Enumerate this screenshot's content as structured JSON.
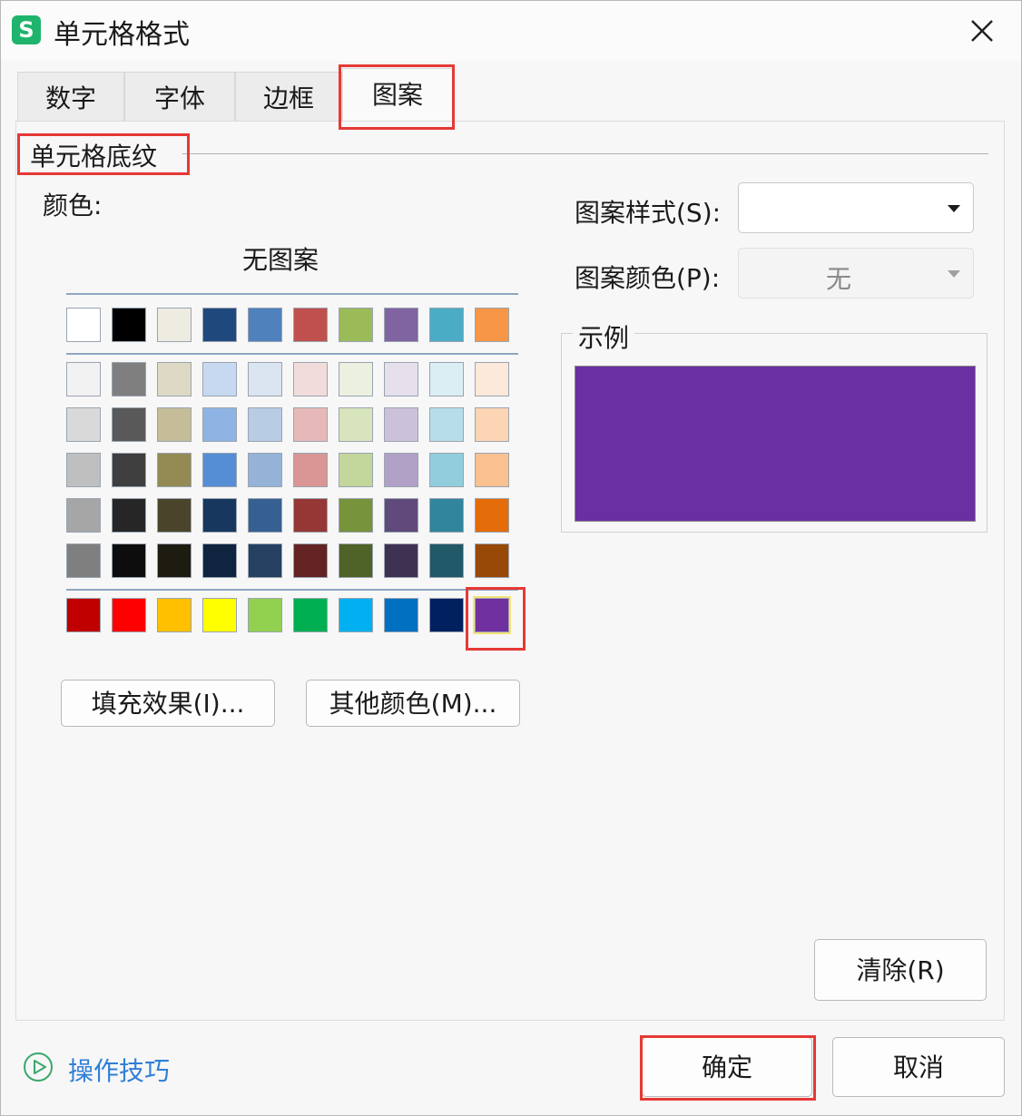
{
  "window": {
    "title": "单元格格式",
    "app_icon_letter": "S"
  },
  "tabs": [
    {
      "label": "数字",
      "active": false
    },
    {
      "label": "字体",
      "active": false
    },
    {
      "label": "边框",
      "active": false
    },
    {
      "label": "图案",
      "active": true
    }
  ],
  "shading": {
    "group_title": "单元格底纹",
    "color_label": "颜色:",
    "no_pattern_label": "无图案",
    "row1": [
      "#ffffff",
      "#000000",
      "#eeece1",
      "#1f497d",
      "#4f81bd",
      "#c0504d",
      "#9bbb59",
      "#8064a2",
      "#4bacc6",
      "#f79646"
    ],
    "tints": [
      [
        "#f2f2f2",
        "#7f7f7f",
        "#ddd9c4",
        "#c6d9f1",
        "#dbe5f1",
        "#f2dcdb",
        "#ebf1de",
        "#e5e0ec",
        "#dbeef3",
        "#fde9d9"
      ],
      [
        "#d9d9d9",
        "#595959",
        "#c4bd97",
        "#8eb4e3",
        "#b8cce4",
        "#e6b9b8",
        "#d7e4bc",
        "#ccc1da",
        "#b7dee8",
        "#fcd5b4"
      ],
      [
        "#bfbfbf",
        "#3f3f3f",
        "#948a54",
        "#558ed5",
        "#95b3d7",
        "#d99694",
        "#c3d69b",
        "#b2a1c7",
        "#92cddc",
        "#fac090"
      ],
      [
        "#a6a6a6",
        "#262626",
        "#4a452a",
        "#17375e",
        "#366092",
        "#953735",
        "#77933c",
        "#604a7b",
        "#31859c",
        "#e46c0a"
      ],
      [
        "#7f7f7f",
        "#0d0d0d",
        "#1e1c11",
        "#0f243e",
        "#254061",
        "#632423",
        "#4f6228",
        "#3f3151",
        "#215968",
        "#984807"
      ]
    ],
    "standard": [
      "#c00000",
      "#ff0000",
      "#ffc000",
      "#ffff00",
      "#92d050",
      "#00b050",
      "#00b0f0",
      "#0070c0",
      "#002060",
      "#7030a0"
    ],
    "selected_color": "#7030a0",
    "fill_effects_button": "填充效果(I)...",
    "more_colors_button": "其他颜色(M)..."
  },
  "pattern": {
    "style_label": "图案样式(S):",
    "style_value": "",
    "color_label": "图案颜色(P):",
    "color_value": "无"
  },
  "sample": {
    "title": "示例",
    "fill": "#6a2fa0"
  },
  "buttons": {
    "clear": "清除(R)",
    "ok": "确定",
    "cancel": "取消"
  },
  "footer": {
    "tips_label": "操作技巧"
  },
  "colors": {
    "highlight": "#e53935",
    "link": "#2f7fd8",
    "app_icon": "#1fb46d"
  }
}
